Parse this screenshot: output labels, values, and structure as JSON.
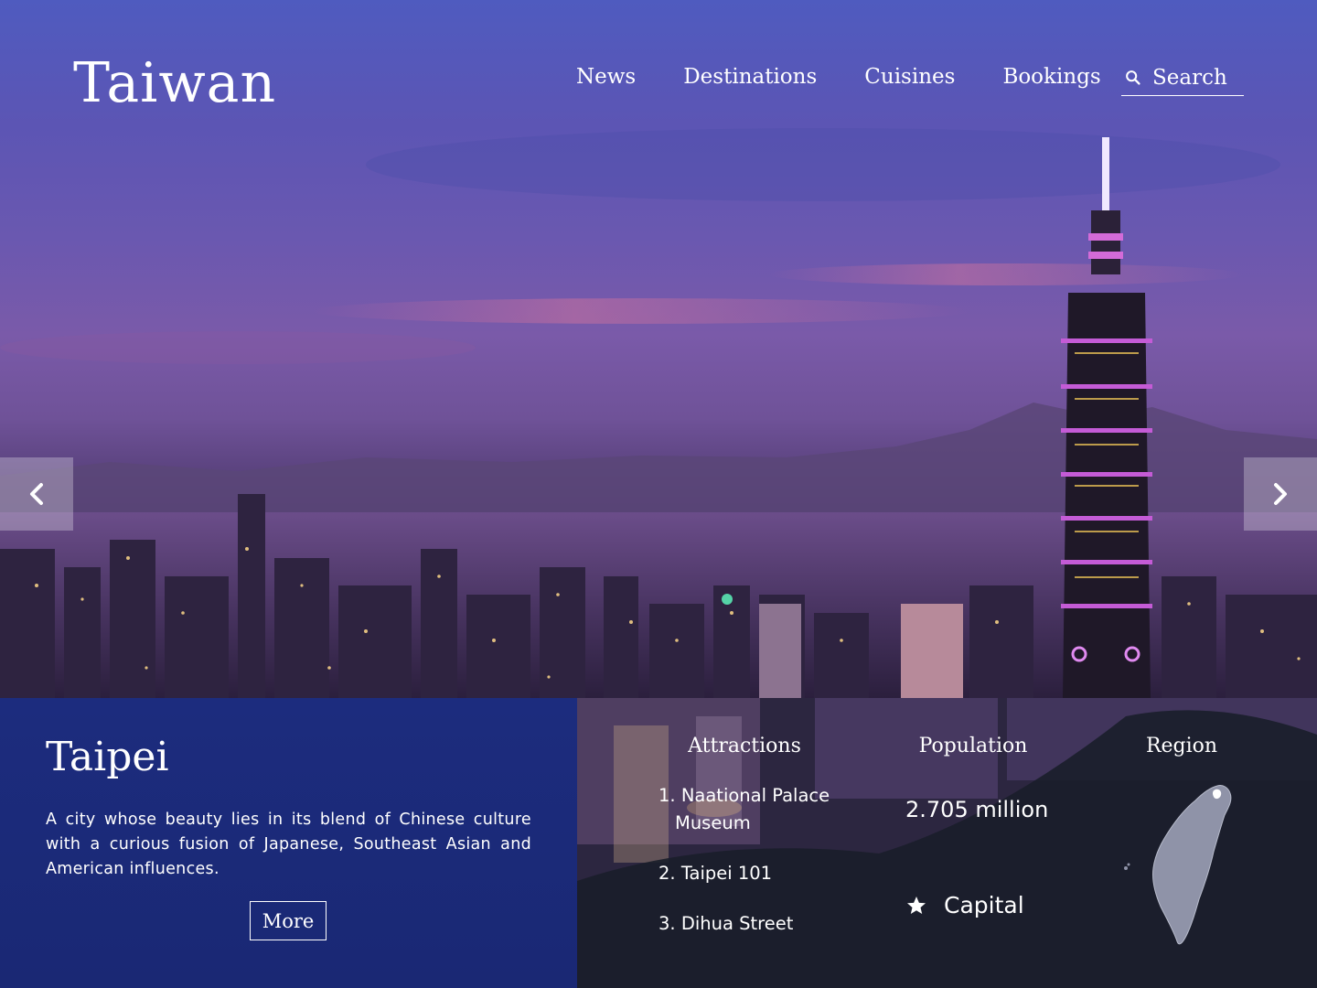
{
  "header": {
    "logo": "Taiwan",
    "nav": [
      {
        "label": "News",
        "name": "nav-news"
      },
      {
        "label": "Destinations",
        "name": "nav-destinations"
      },
      {
        "label": "Cuisines",
        "name": "nav-cuisines"
      },
      {
        "label": "Bookings",
        "name": "nav-bookings"
      }
    ],
    "search": {
      "placeholder": "Search",
      "icon": "search-icon"
    }
  },
  "carousel": {
    "prev_icon": "chevron-left-icon",
    "next_icon": "chevron-right-icon"
  },
  "city": {
    "name": "Taipei",
    "description": "A city whose beauty lies in its blend of Chinese culture with a curious fusion of Japanese, Southeast Asian and American influences.",
    "more_label": "More"
  },
  "facts": {
    "attractions_heading": "Attractions",
    "attractions": [
      {
        "num": "1.",
        "line1": "Naational Palace",
        "line2": "Museum"
      },
      {
        "num": "2.",
        "line1": "Taipei 101",
        "line2": ""
      },
      {
        "num": "3.",
        "line1": "Dihua Street",
        "line2": ""
      }
    ],
    "population_heading": "Population",
    "population_value": "2.705 million",
    "capital_label": "Capital",
    "capital_icon": "star-icon",
    "region_heading": "Region",
    "region_icon": "taiwan-map-icon"
  },
  "colors": {
    "info_panel": "#1c2c7e",
    "sky_top": "#4f5bbf",
    "sky_mid": "#7a5aa9"
  }
}
